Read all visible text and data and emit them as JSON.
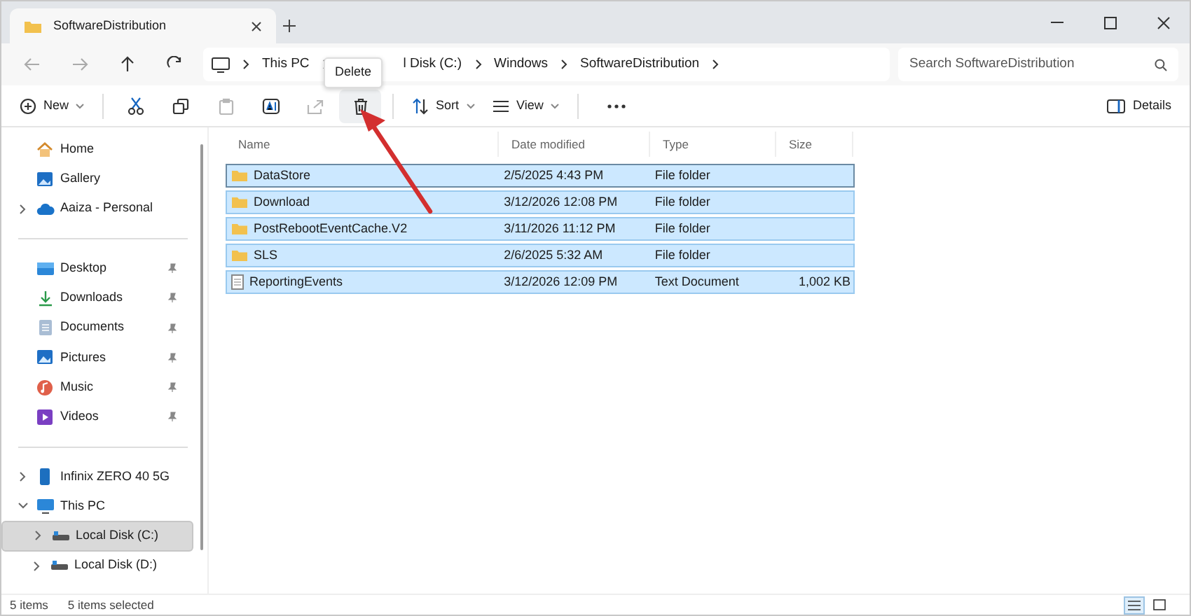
{
  "tabs": [
    {
      "label": "SoftwareDistribution",
      "selected": true
    }
  ],
  "address": {
    "crumbs": [
      "This PC",
      "l Disk (C:)",
      "Windows",
      "SoftwareDistribution"
    ],
    "search_placeholder": "Search SoftwareDistribution"
  },
  "tooltip": "Delete",
  "toolbar": [
    {
      "kind": "new",
      "label": "New",
      "disabled": false,
      "hovered": false
    },
    {
      "kind": "cut",
      "disabled": false,
      "hovered": false
    },
    {
      "kind": "copy",
      "disabled": false,
      "hovered": false
    },
    {
      "kind": "paste",
      "disabled": true,
      "hovered": false
    },
    {
      "kind": "rename",
      "disabled": false,
      "hovered": false
    },
    {
      "kind": "share",
      "disabled": true,
      "hovered": false
    },
    {
      "kind": "delete",
      "disabled": false,
      "hovered": true
    },
    {
      "kind": "sort",
      "label": "Sort",
      "disabled": false,
      "hovered": false
    },
    {
      "kind": "view",
      "label": "View",
      "disabled": false,
      "hovered": false
    },
    {
      "kind": "more",
      "disabled": false,
      "hovered": false
    }
  ],
  "details_button": "Details",
  "sidebar": [
    {
      "kind": "home",
      "label": "Home",
      "selected": false
    },
    {
      "kind": "gallery",
      "label": "Gallery",
      "selected": false
    },
    {
      "kind": "cloud",
      "label": "Aaiza - Personal",
      "expanded": false,
      "selected": false
    },
    {
      "kind": "divider"
    },
    {
      "kind": "desktop",
      "label": "Desktop",
      "pinned": true,
      "selected": false
    },
    {
      "kind": "downloads",
      "label": "Downloads",
      "pinned": true,
      "selected": false
    },
    {
      "kind": "documents",
      "label": "Documents",
      "pinned": true,
      "selected": false
    },
    {
      "kind": "pictures",
      "label": "Pictures",
      "pinned": true,
      "selected": false
    },
    {
      "kind": "music",
      "label": "Music",
      "pinned": true,
      "selected": false
    },
    {
      "kind": "videos",
      "label": "Videos",
      "pinned": true,
      "selected": false
    },
    {
      "kind": "divider"
    },
    {
      "kind": "phone",
      "label": "Infinix ZERO 40 5G",
      "expanded": false,
      "selected": false
    },
    {
      "kind": "pc",
      "label": "This PC",
      "expanded": true,
      "selected": false
    },
    {
      "kind": "disk",
      "label": "Local Disk (C:)",
      "expanded": false,
      "selected": true,
      "sub": true
    },
    {
      "kind": "disk",
      "label": "Local Disk (D:)",
      "expanded": false,
      "selected": false,
      "sub": true
    }
  ],
  "table": {
    "columns": [
      "Name",
      "Date modified",
      "Type",
      "Size"
    ],
    "rows": [
      {
        "kind": "folder",
        "name": "DataStore",
        "date": "2/5/2025 4:43 PM",
        "type": "File folder",
        "selected": true,
        "focused": true
      },
      {
        "kind": "folder",
        "name": "Download",
        "date": "3/12/2026 12:08 PM",
        "type": "File folder",
        "selected": true,
        "focused": false
      },
      {
        "kind": "folder",
        "name": "PostRebootEventCache.V2",
        "date": "3/11/2026 11:12 PM",
        "type": "File folder",
        "selected": true,
        "focused": false
      },
      {
        "kind": "folder",
        "name": "SLS",
        "date": "2/6/2025 5:32 AM",
        "type": "File folder",
        "selected": true,
        "focused": false
      },
      {
        "kind": "text",
        "name": "ReportingEvents",
        "date": "3/12/2026 12:09 PM",
        "type": "Text Document",
        "size": "1,002 KB",
        "selected": true,
        "focused": false
      }
    ]
  },
  "status_bar": {
    "count": "5 items",
    "selection": "5 items selected",
    "views": [
      {
        "kind": "details",
        "selected": true
      },
      {
        "kind": "tiles",
        "selected": false
      }
    ]
  }
}
